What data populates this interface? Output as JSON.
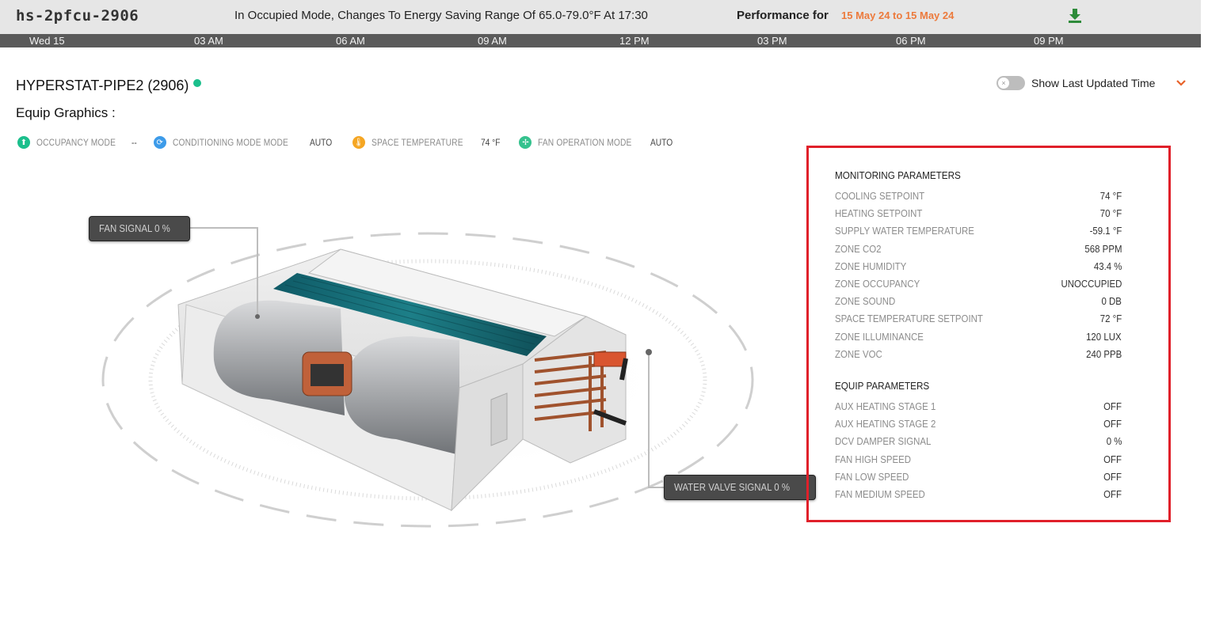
{
  "header": {
    "device_name": "hs-2pfcu-2906",
    "banner": "In Occupied Mode, Changes To Energy Saving Range Of 65.0-79.0°F At 17:30",
    "performance_label": "Performance for",
    "performance_range": "15 May 24 to 15 May 24",
    "download_icon": "download-icon"
  },
  "timeline": {
    "ticks": [
      "Wed 15",
      "03 AM",
      "06 AM",
      "09 AM",
      "12 PM",
      "03 PM",
      "06 PM",
      "09 PM"
    ]
  },
  "equip": {
    "title": "HYPERSTAT-PIPE2 (2906)",
    "status_color": "#1bbf8c",
    "graphics_label": "Equip Graphics :",
    "toggle_label": "Show Last Updated Time"
  },
  "status": [
    {
      "label": "OCCUPANCY MODE",
      "value": "--",
      "icon": "person-icon",
      "color": "#1bbf8c"
    },
    {
      "label": "CONDITIONING MODE MODE",
      "value": "AUTO",
      "icon": "sync-icon",
      "color": "#3d9be9"
    },
    {
      "label": "SPACE TEMPERATURE",
      "value": "74 °F",
      "icon": "thermometer-icon",
      "color": "#f5a623"
    },
    {
      "label": "FAN OPERATION MODE",
      "value": "AUTO",
      "icon": "fan-icon",
      "color": "#35c28e"
    }
  ],
  "callouts": {
    "fan_signal": "FAN SIGNAL 0 %",
    "water_valve_signal": "WATER VALVE SIGNAL   0 %"
  },
  "monitoring": {
    "title": "MONITORING PARAMETERS",
    "rows": [
      {
        "k": "COOLING SETPOINT",
        "v": "74 °F"
      },
      {
        "k": "HEATING SETPOINT",
        "v": "70 °F"
      },
      {
        "k": "SUPPLY WATER TEMPERATURE",
        "v": "-59.1 °F"
      },
      {
        "k": "ZONE CO2",
        "v": "568 PPM"
      },
      {
        "k": "ZONE HUMIDITY",
        "v": "43.4 %"
      },
      {
        "k": "ZONE OCCUPANCY",
        "v": "UNOCCUPIED"
      },
      {
        "k": "ZONE SOUND",
        "v": "0 DB"
      },
      {
        "k": "SPACE TEMPERATURE SETPOINT",
        "v": "72 °F"
      },
      {
        "k": "ZONE ILLUMINANCE",
        "v": "120 LUX"
      },
      {
        "k": "ZONE VOC",
        "v": "240 PPB"
      }
    ]
  },
  "equip_params": {
    "title": "EQUIP PARAMETERS",
    "rows": [
      {
        "k": "AUX HEATING STAGE 1",
        "v": "OFF"
      },
      {
        "k": "AUX HEATING STAGE 2",
        "v": "OFF"
      },
      {
        "k": "DCV DAMPER SIGNAL",
        "v": "0 %"
      },
      {
        "k": "FAN HIGH SPEED",
        "v": "OFF"
      },
      {
        "k": "FAN LOW SPEED",
        "v": "OFF"
      },
      {
        "k": "FAN MEDIUM SPEED",
        "v": "OFF"
      }
    ]
  }
}
